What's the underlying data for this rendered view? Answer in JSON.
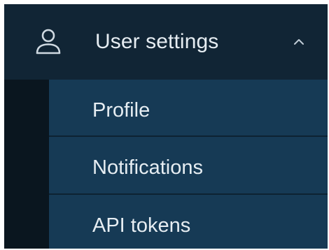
{
  "menu": {
    "header": {
      "title": "User settings",
      "icon": "user-icon",
      "toggle_icon": "chevron-up-icon",
      "expanded": true
    },
    "items": [
      {
        "label": "Profile"
      },
      {
        "label": "Notifications"
      },
      {
        "label": "API tokens"
      }
    ]
  },
  "colors": {
    "header_bg": "#112535",
    "submenu_bg": "#163a55",
    "gutter_bg": "#0a161f",
    "text": "#e6edf2"
  }
}
